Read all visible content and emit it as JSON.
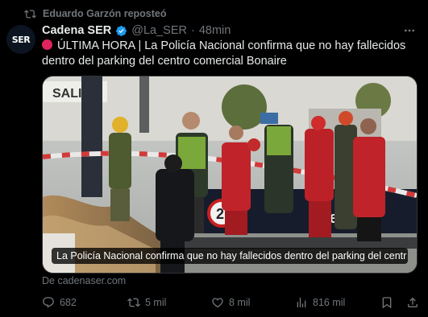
{
  "repost": {
    "text": "Eduardo Garzón reposteó",
    "icon": "repost-icon"
  },
  "author": {
    "avatar_text": "SER",
    "name": "Cadena SER",
    "handle": "@La_SER",
    "separator": "·",
    "time": "48min",
    "verified_icon": "verified-badge-icon"
  },
  "tweet": {
    "text": "ÚLTIMA HORA | La Policía Nacional confirma que no hay fallecidos dentro del parking del centro comercial Bonaire"
  },
  "media": {
    "caption": "La Policía Nacional confirma que no hay fallecidos dentro del parking del centr…",
    "sign_left": "SALI",
    "sign_right": "2",
    "sign_brand": "ienda"
  },
  "card": {
    "source": "De cadenaser.com"
  },
  "actions": {
    "replies": "682",
    "reposts": "5 mil",
    "likes": "8 mil",
    "views": "816 mil"
  },
  "colors": {
    "background": "#000000",
    "text": "#e7e9ea",
    "muted": "#71767b",
    "verified": "#1d9bf0",
    "alert": "#e0245e"
  }
}
